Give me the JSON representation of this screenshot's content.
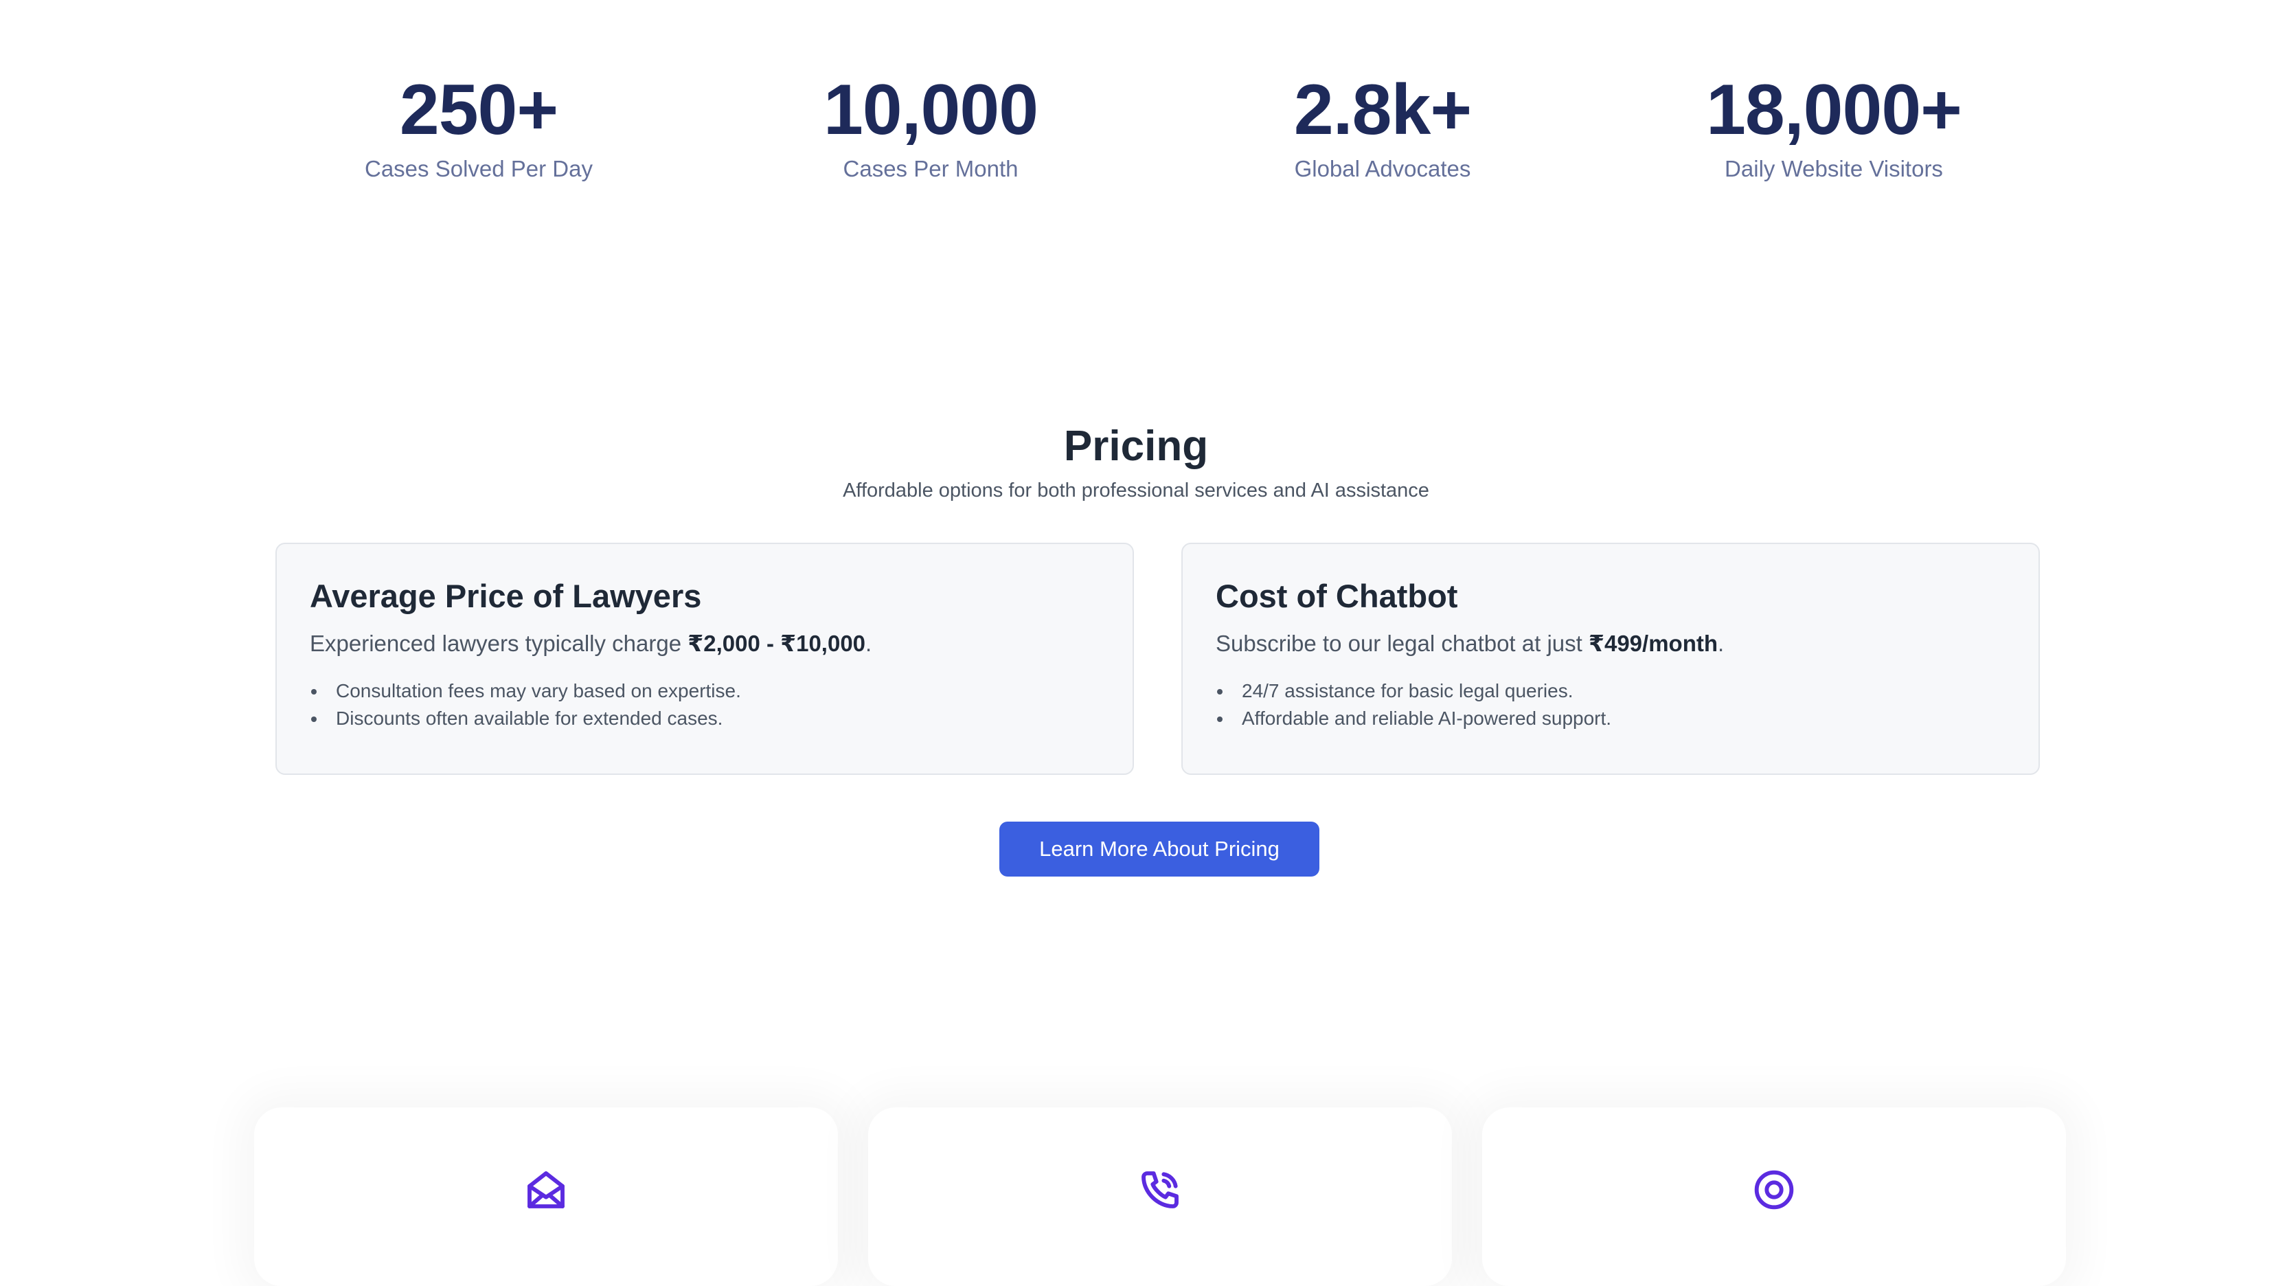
{
  "stats": [
    {
      "value": "250+",
      "label": "Cases Solved Per Day"
    },
    {
      "value": "10,000",
      "label": "Cases Per Month"
    },
    {
      "value": "2.8k+",
      "label": "Global Advocates"
    },
    {
      "value": "18,000+",
      "label": "Daily Website Visitors"
    }
  ],
  "pricing": {
    "title": "Pricing",
    "subtitle": "Affordable options for both professional services and AI assistance",
    "cards": [
      {
        "title": "Average Price of Lawyers",
        "desc_prefix": "Experienced lawyers typically charge ",
        "desc_highlight": "₹2,000 - ₹10,000",
        "desc_suffix": ".",
        "bullets": [
          "Consultation fees may vary based on expertise.",
          "Discounts often available for extended cases."
        ]
      },
      {
        "title": "Cost of Chatbot",
        "desc_prefix": "Subscribe to our legal chatbot at just ",
        "desc_highlight": "₹499/month",
        "desc_suffix": ".",
        "bullets": [
          "24/7 assistance for basic legal queries.",
          "Affordable and reliable AI-powered support."
        ]
      }
    ],
    "cta_label": "Learn More About Pricing"
  },
  "contact": {
    "icons": [
      "mail-open-icon",
      "phone-call-icon",
      "location-target-icon"
    ]
  },
  "colors": {
    "stat_value": "#1e2a5a",
    "stat_label": "#64709a",
    "accent_button": "#3b5fe0",
    "icon_purple": "#5b2be0",
    "card_bg": "#f7f8fa"
  }
}
